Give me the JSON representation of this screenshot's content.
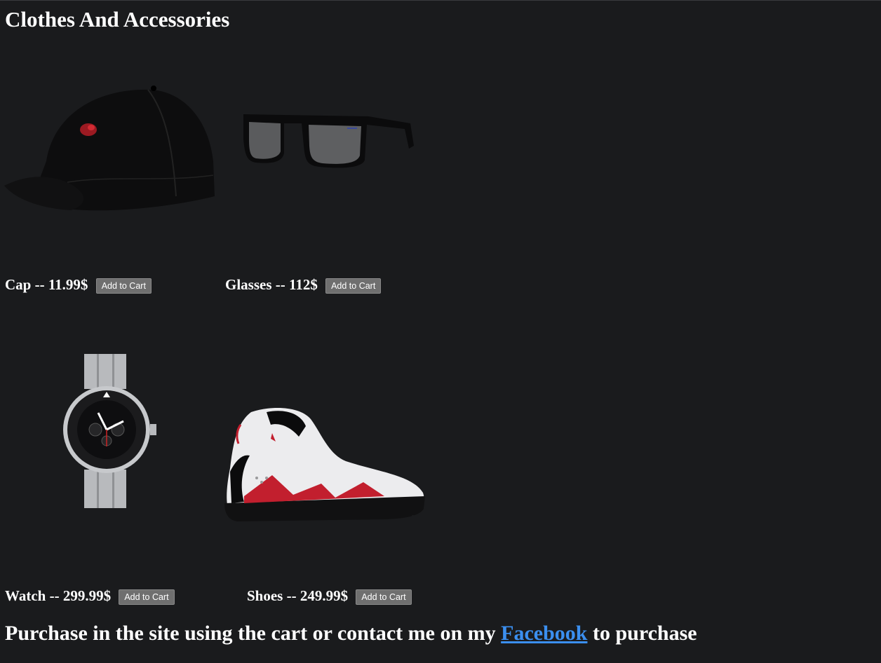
{
  "page": {
    "title": "Clothes And Accessories"
  },
  "products": [
    {
      "name": "Cap -- 11.99$",
      "button": "Add to Cart",
      "image_icon": "cap-icon"
    },
    {
      "name": "Glasses -- 112$",
      "button": "Add to Cart",
      "image_icon": "sunglasses-icon"
    },
    {
      "name": "Watch -- 299.99$",
      "button": "Add to Cart",
      "image_icon": "watch-icon"
    },
    {
      "name": "Shoes -- 249.99$",
      "button": "Add to Cart",
      "image_icon": "sneaker-icon"
    }
  ],
  "footer": {
    "before": "Purchase in the site using the cart or contact me on my ",
    "link": "Facebook",
    "after": " to purchase"
  },
  "colors": {
    "background": "#1a1b1d",
    "text": "#ffffff",
    "button": "#6f6f6f",
    "link": "#3b8ff0"
  }
}
